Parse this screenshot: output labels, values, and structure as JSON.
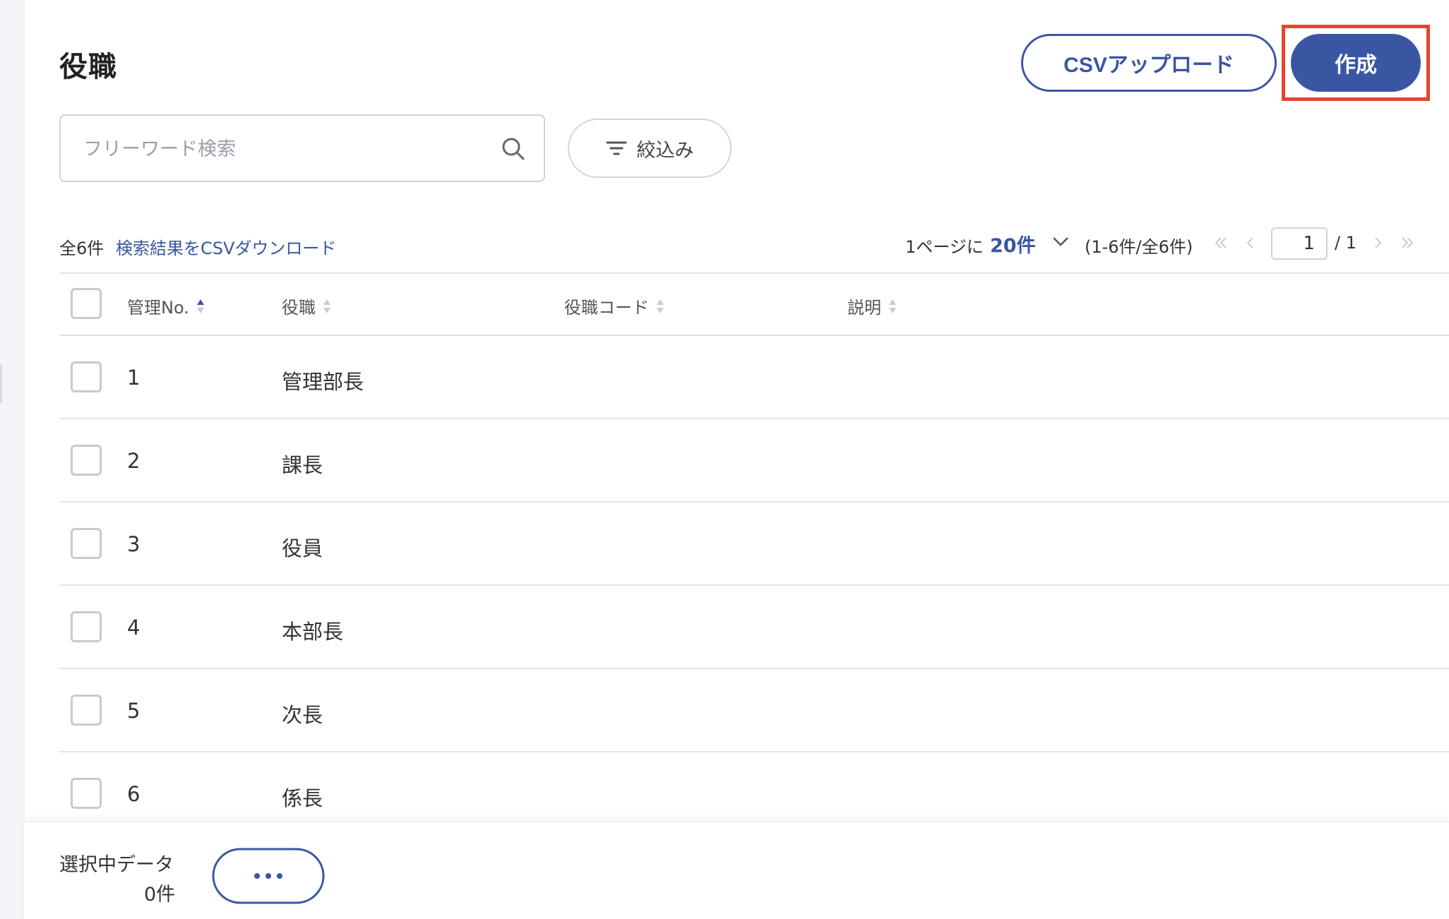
{
  "page": {
    "title": "役職"
  },
  "header": {
    "csv_upload_label": "CSVアップロード",
    "create_label": "作成"
  },
  "search": {
    "placeholder": "フリーワード検索",
    "value": ""
  },
  "filter": {
    "label": "絞込み"
  },
  "results": {
    "total": "全6件",
    "csv_download_label": "検索結果をCSVダウンロード"
  },
  "pagination": {
    "per_page_label": "1ページに",
    "per_page_value": "20件",
    "range": "(1-6件/全6件)",
    "current_page": "1",
    "total_pages": "/ 1"
  },
  "table": {
    "columns": [
      {
        "label": "管理No.",
        "sort": "asc"
      },
      {
        "label": "役職",
        "sort": "none"
      },
      {
        "label": "役職コード",
        "sort": "none"
      },
      {
        "label": "説明",
        "sort": "none"
      }
    ],
    "rows": [
      {
        "no": "1",
        "name": "管理部長",
        "code": "",
        "description": ""
      },
      {
        "no": "2",
        "name": "課長",
        "code": "",
        "description": ""
      },
      {
        "no": "3",
        "name": "役員",
        "code": "",
        "description": ""
      },
      {
        "no": "4",
        "name": "本部長",
        "code": "",
        "description": ""
      },
      {
        "no": "5",
        "name": "次長",
        "code": "",
        "description": ""
      },
      {
        "no": "6",
        "name": "係長",
        "code": "",
        "description": ""
      }
    ]
  },
  "footer": {
    "selected_label": "選択中データ",
    "selected_count": "0件",
    "more_icon": "more-horizontal-icon"
  },
  "colors": {
    "primary": "#3a56a3",
    "highlight": "#e8432d",
    "border": "#cfd2da"
  }
}
